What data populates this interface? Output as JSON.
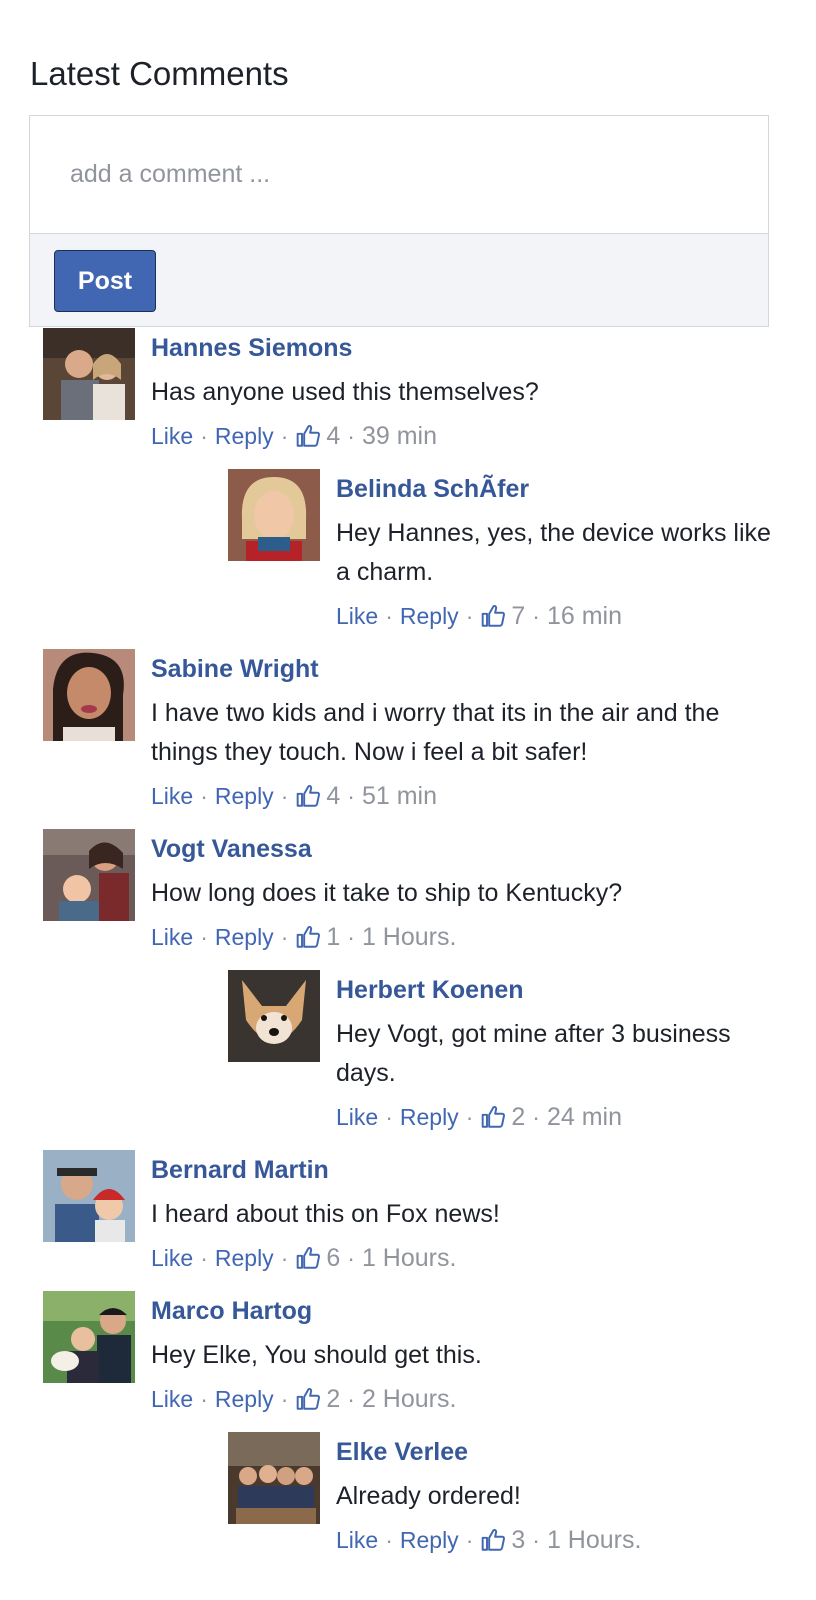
{
  "section_title": "Latest Comments",
  "composer": {
    "placeholder": "add a comment ...",
    "post_label": "Post"
  },
  "actions": {
    "like": "Like",
    "reply": "Reply",
    "sep": "·"
  },
  "comments": [
    {
      "name": "Hannes Siemons",
      "text": "Has anyone used this themselves?",
      "likes": "4",
      "time": "39 min",
      "avatar": "avatar-couple"
    },
    {
      "name": "Belinda SchÃfer",
      "text": "Hey Hannes, yes, the device works like a charm.",
      "likes": "7",
      "time": "16 min",
      "avatar": "avatar-woman-blonde"
    },
    {
      "name": "Sabine Wright",
      "text": "I have two kids and i worry that its in the air and the things they touch. Now i feel a bit safer!",
      "likes": "4",
      "time": "51 min",
      "avatar": "avatar-woman-selfie"
    },
    {
      "name": "Vogt Vanessa",
      "text": "How long does it take to ship to Kentucky?",
      "likes": "1",
      "time": "1 Hours.",
      "avatar": "avatar-mother-child"
    },
    {
      "name": "Herbert Koenen",
      "text": "Hey Vogt, got mine after 3 business days.",
      "likes": "2",
      "time": "24 min",
      "avatar": "avatar-dog"
    },
    {
      "name": "Bernard Martin",
      "text": "I heard about this on Fox news!",
      "likes": "6",
      "time": "1 Hours.",
      "avatar": "avatar-father-son"
    },
    {
      "name": "Marco Hartog",
      "text": "Hey Elke, You should get this.",
      "likes": "2",
      "time": "2 Hours.",
      "avatar": "avatar-couple-outdoor"
    },
    {
      "name": "Elke Verlee",
      "text": "Already ordered!",
      "likes": "3",
      "time": "1 Hours.",
      "avatar": "avatar-group"
    }
  ]
}
